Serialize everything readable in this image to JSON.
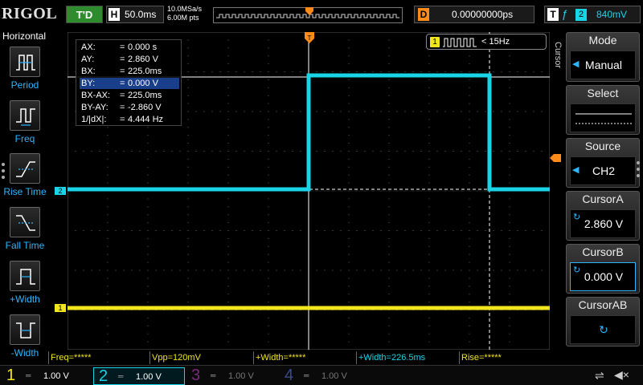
{
  "top": {
    "logo": "RIGOL",
    "run_status": "T'D",
    "timebase_letter": "H",
    "timebase": "50.0ms",
    "sample_rate": "10.0MSa/s",
    "memory_depth": "6.00M pts",
    "delay_letter": "D",
    "delay": "0.00000000ps",
    "trigger_letter": "T",
    "trigger_edge": "ƒ",
    "trigger_source": "2",
    "trigger_level": "840mV"
  },
  "left_menu": {
    "title": "Horizontal",
    "items": [
      {
        "label": "Period",
        "icon": "period-icon"
      },
      {
        "label": "Freq",
        "icon": "freq-icon"
      },
      {
        "label": "Rise Time",
        "icon": "rise-time-icon"
      },
      {
        "label": "Fall Time",
        "icon": "fall-time-icon"
      },
      {
        "label": "+Width",
        "icon": "positive-width-icon"
      },
      {
        "label": "-Width",
        "icon": "negative-width-icon"
      }
    ]
  },
  "cursor_readout": [
    {
      "key": "AX:",
      "value": "0.000 s"
    },
    {
      "key": "AY:",
      "value": "2.860 V"
    },
    {
      "key": "BX:",
      "value": "225.0ms"
    },
    {
      "key": "BY:",
      "value": "0.000 V"
    },
    {
      "key": "BX-AX:",
      "value": "225.0ms"
    },
    {
      "key": "BY-AY:",
      "value": "-2.860 V"
    },
    {
      "key": "1/|dX|:",
      "value": "4.444 Hz"
    }
  ],
  "ch1_freq_badge": {
    "channel": "1",
    "text": "< 15Hz"
  },
  "channel_markers": {
    "ch1": "1",
    "ch2": "2"
  },
  "measure_bar": [
    {
      "text": "Freq=*****"
    },
    {
      "text": "Vpp=120mV"
    },
    {
      "text": "+Width=*****"
    },
    {
      "text": "+Width=226.5ms"
    },
    {
      "text": "Rise=*****"
    }
  ],
  "channels": [
    {
      "num": "1",
      "scale": "1.00 V",
      "color": "#f1e51e"
    },
    {
      "num": "2",
      "scale": "1.00 V",
      "color": "#19d3e6"
    },
    {
      "num": "3",
      "scale": "1.00 V",
      "color": "#7a2a7a"
    },
    {
      "num": "4",
      "scale": "1.00 V",
      "color": "#3a4a8a"
    }
  ],
  "right_menu": {
    "title": "Cursor",
    "mode": {
      "label": "Mode",
      "value": "Manual"
    },
    "select": {
      "label": "Select"
    },
    "source": {
      "label": "Source",
      "value": "CH2"
    },
    "cursor_a": {
      "label": "CursorA",
      "value": "2.860 V"
    },
    "cursor_b": {
      "label": "CursorB",
      "value": "0.000 V"
    },
    "cursor_ab": {
      "label": "CursorAB"
    }
  },
  "colors": {
    "ch1": "#f1e51e",
    "ch2": "#19d3e6",
    "trigger": "#ff8c1a",
    "accent": "#2fb5ff"
  }
}
